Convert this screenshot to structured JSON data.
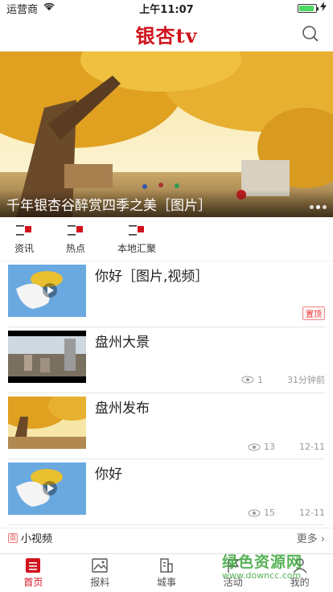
{
  "status": {
    "carrier": "运营商",
    "time": "上午11:07",
    "battery_level": 0.9
  },
  "header": {
    "title": "银杏tv"
  },
  "banner": {
    "caption": "千年银杏谷醉赏四季之美［图片］",
    "dot_count": 3,
    "active_dot": 1
  },
  "quick_nav": [
    {
      "label": "资讯",
      "icon": "news-icon"
    },
    {
      "label": "热点",
      "icon": "hot-icon"
    },
    {
      "label": "本地汇聚",
      "icon": "local-icon"
    }
  ],
  "news": [
    {
      "title": "你好［图片,视频］",
      "badge": "置顶",
      "views": "",
      "time": "",
      "thumb": "dove"
    },
    {
      "title": "盘州大景",
      "badge": "",
      "views": "1",
      "time": "31分钟前",
      "thumb": "city"
    },
    {
      "title": "盘州发布",
      "badge": "",
      "views": "13",
      "time": "12-11",
      "thumb": "tree"
    },
    {
      "title": "你好",
      "badge": "",
      "views": "15",
      "time": "12-11",
      "thumb": "dove"
    }
  ],
  "short_video": {
    "icon_text": "盘",
    "title": "小视频",
    "more": "更多 ›"
  },
  "tabs": [
    {
      "label": "首页",
      "icon": "home-icon",
      "active": true
    },
    {
      "label": "报料",
      "icon": "image-icon",
      "active": false
    },
    {
      "label": "城事",
      "icon": "building-icon",
      "active": false
    },
    {
      "label": "活动",
      "icon": "flag-icon",
      "active": false
    },
    {
      "label": "我的",
      "icon": "user-icon",
      "active": false
    }
  ],
  "watermark": {
    "main": "绿色资源网",
    "url": "www.downcc.com"
  },
  "colors": {
    "brand": "#d0131c",
    "watermark": "#3aa53a"
  }
}
